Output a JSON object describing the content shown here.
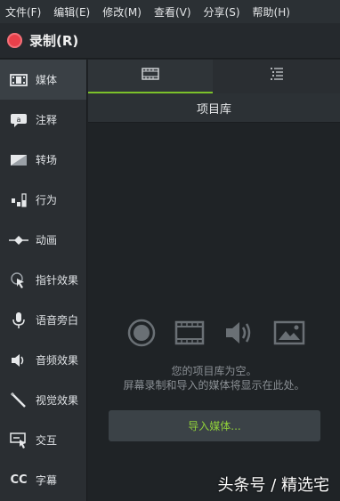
{
  "menu": [
    "文件(F)",
    "编辑(E)",
    "修改(M)",
    "查看(V)",
    "分享(S)",
    "帮助(H)"
  ],
  "record": {
    "label": "录制(R)"
  },
  "sidebar": {
    "items": [
      {
        "label": "媒体",
        "icon": "film-icon",
        "active": true
      },
      {
        "label": "注释",
        "icon": "callout-icon"
      },
      {
        "label": "转场",
        "icon": "transition-icon"
      },
      {
        "label": "行为",
        "icon": "behaviors-icon"
      },
      {
        "label": "动画",
        "icon": "animation-icon"
      },
      {
        "label": "指针效果",
        "icon": "cursor-effect-icon"
      },
      {
        "label": "语音旁白",
        "icon": "microphone-icon"
      },
      {
        "label": "音频效果",
        "icon": "speaker-icon"
      },
      {
        "label": "视觉效果",
        "icon": "magic-wand-icon"
      },
      {
        "label": "交互",
        "icon": "interactivity-icon"
      },
      {
        "label": "字幕",
        "icon": "captions-icon"
      }
    ]
  },
  "tabs": [
    {
      "icon": "film-icon",
      "active": true
    },
    {
      "icon": "list-icon"
    }
  ],
  "library": {
    "title": "项目库",
    "empty_line1": "您的项目库为空。",
    "empty_line2": "屏幕录制和导入的媒体将显示在此处。",
    "import_label": "导入媒体...",
    "icons": [
      "record-icon",
      "film-icon",
      "speaker-icon",
      "image-icon"
    ]
  },
  "watermark": "头条号 / 精选宅",
  "colors": {
    "accent": "#7cc12a",
    "record": "#e8404a",
    "import_text": "#8fcf3a"
  }
}
